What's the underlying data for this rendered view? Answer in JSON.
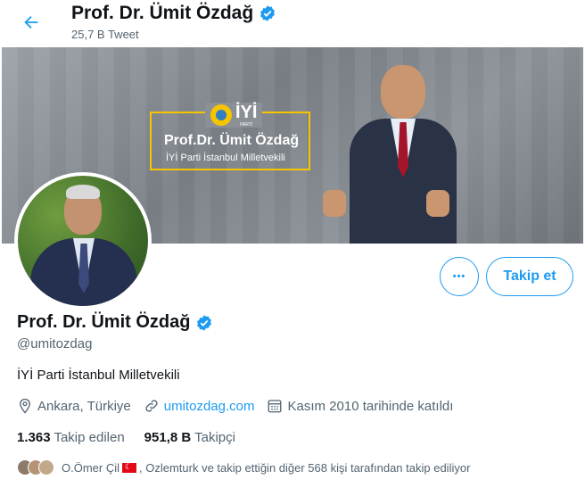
{
  "header": {
    "title": "Prof. Dr. Ümit Özdağ",
    "subtitle": "25,7 B Tweet"
  },
  "banner": {
    "party_name": "İYİ",
    "party_mini": "PARTİ",
    "name": "Prof.Dr. Ümit Özdağ",
    "role": "İYİ Parti İstanbul Milletvekili"
  },
  "actions": {
    "more_label": "•••",
    "follow_label": "Takip et"
  },
  "profile": {
    "name": "Prof. Dr. Ümit Özdağ",
    "handle": "@umitozdag",
    "bio": "İYİ Parti İstanbul Milletvekili",
    "location": "Ankara, Türkiye",
    "website": "umitozdag.com",
    "joined": "Kasım 2010 tarihinde katıldı"
  },
  "stats": {
    "following_value": "1.363",
    "following_label": "Takip edilen",
    "followers_value": "951,8 B",
    "followers_label": "Takipçi"
  },
  "followed_by": {
    "text_before": "O.Ömer Çil",
    "text_after": ", Ozlemturk ve takip ettiğin diğer 568 kişi tarafından takip ediliyor"
  },
  "colors": {
    "accent": "#1d9bf0",
    "secondary_text": "#536471",
    "party_yellow": "#f7c400"
  },
  "icons": {
    "back": "arrow-left-icon",
    "verified": "verified-badge-icon",
    "location": "location-pin-icon",
    "link": "link-icon",
    "calendar": "calendar-icon"
  }
}
